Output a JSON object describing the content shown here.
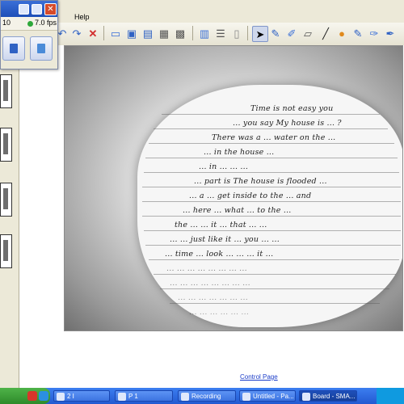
{
  "menu": {
    "help_label": "Help"
  },
  "toolbox": {
    "number": "10",
    "fps": "7.0 fps",
    "close_glyph": "✕"
  },
  "toolbar": {
    "tools": [
      "undo-icon",
      "redo-icon",
      "delete-icon",
      "screen-icon",
      "monitor-icon",
      "display-icon",
      "capture-icon",
      "scanner-icon",
      "page-icon",
      "list-icon",
      "doc-icon",
      "select-arrow-icon",
      "pen-icon",
      "highlighter-icon",
      "eraser-icon",
      "line-icon",
      "fill-icon",
      "creative-pen-icon",
      "magic-pen-icon",
      "more-icon"
    ]
  },
  "colors": {
    "accent": "#2259d1",
    "toolbar": "#ece9d8",
    "close": "#d54b2a",
    "status_green": "#2ea83a"
  },
  "handwriting": [
    "Time is not easy you",
    "... you say My house is ... ?",
    "There was a ... water on the ...",
    "... in the house ...",
    "... in ... ... ...",
    "... part is The house is flooded ...",
    "... a ... get inside to the ... and",
    "... here ... what ... to the ...",
    "the ... ... it ... that ... ...",
    "... ... just like it ... you ... ...",
    "... time ... look ... ... ... it ...",
    "... ... ... ... ... ... ... ...",
    "... ... ... ... ... ... ... ...",
    "... ... ... ... ... ... ...",
    "... ... ... ... ... ..."
  ],
  "link": {
    "text": "Control Page"
  },
  "taskbar": {
    "items": [
      {
        "label": "2 I",
        "icon": "browser-icon"
      },
      {
        "label": "P 1",
        "icon": "folder-icon"
      },
      {
        "label": "Recording",
        "icon": "record-icon"
      },
      {
        "label": "Untitled - Pa...",
        "icon": "paint-icon"
      },
      {
        "label": "Board - SMA...",
        "icon": "board-icon"
      }
    ]
  }
}
